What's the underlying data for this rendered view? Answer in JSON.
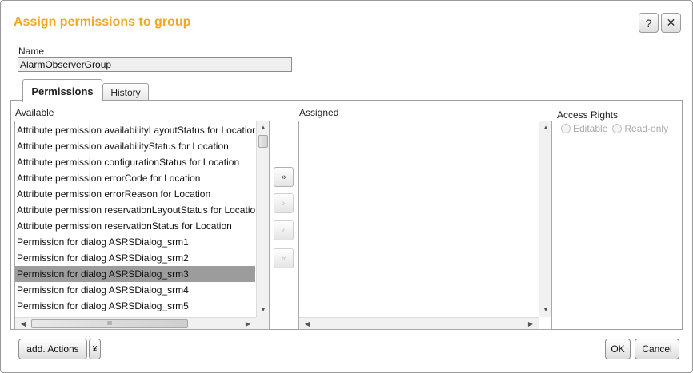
{
  "dialog": {
    "title": "Assign permissions to group",
    "help_label": "?",
    "close_label": "✕"
  },
  "name": {
    "label": "Name",
    "value": "AlarmObserverGroup"
  },
  "tabs": [
    {
      "label": "Permissions",
      "active": true
    },
    {
      "label": "History",
      "active": false
    }
  ],
  "available": {
    "label": "Available",
    "items": [
      "Attribute permission availabilityLayoutStatus for Location",
      "Attribute permission availabilityStatus for Location",
      "Attribute permission configurationStatus for Location",
      "Attribute permission errorCode for Location",
      "Attribute permission errorReason for Location",
      "Attribute permission reservationLayoutStatus for Location",
      "Attribute permission reservationStatus for Location",
      "Permission for dialog ASRSDialog_srm1",
      "Permission for dialog ASRSDialog_srm2",
      "Permission for dialog ASRSDialog_srm3",
      "Permission for dialog ASRSDialog_srm4",
      "Permission for dialog ASRSDialog_srm5"
    ],
    "selected_index": 9,
    "scroll_up_label": "▲",
    "scroll_down_label": "▼",
    "scroll_left_label": "◀",
    "scroll_right_label": "▶",
    "thumb_grip": "III"
  },
  "assigned": {
    "label": "Assigned",
    "items": [],
    "scroll_up_label": "▲",
    "scroll_down_label": "▼",
    "scroll_left_label": "◀",
    "scroll_right_label": "▶"
  },
  "move_buttons": {
    "add_all": "»",
    "add": "›",
    "remove": "‹",
    "remove_all": "«"
  },
  "access_rights": {
    "label": "Access Rights",
    "editable_label": "Editable",
    "readonly_label": "Read-only"
  },
  "footer": {
    "add_actions_label": "add. Actions",
    "add_actions_dropdown": "¥",
    "ok_label": "OK",
    "cancel_label": "Cancel"
  },
  "colors": {
    "title": "#f0a820",
    "selected_row": "#9c9c9c"
  }
}
